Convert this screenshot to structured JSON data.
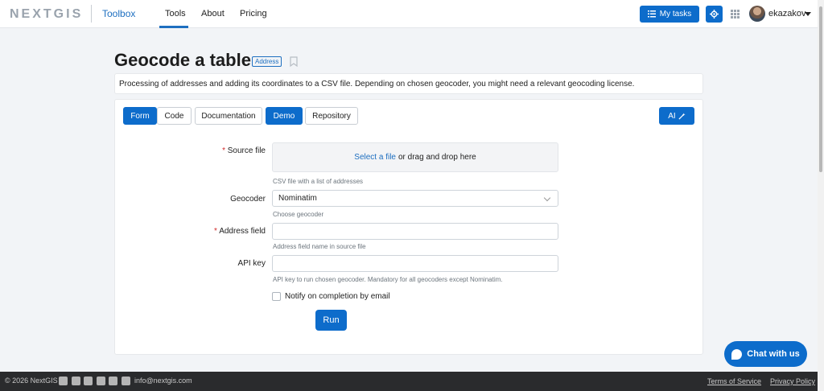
{
  "header": {
    "logo": "NEXTGIS",
    "product": "Toolbox",
    "nav": [
      "Tools",
      "About",
      "Pricing"
    ],
    "my_tasks": "My tasks",
    "username": "ekazakov"
  },
  "page": {
    "title": "Geocode a table",
    "tag": "Address",
    "description": "Processing of addresses and adding its coordinates to a CSV file. Depending on chosen geocoder, you might need a relevant geocoding license."
  },
  "tabs": [
    "Form",
    "Code",
    "Documentation",
    "Demo",
    "Repository"
  ],
  "ai_label": "AI",
  "form": {
    "source_file": {
      "label": "Source file",
      "required": "*",
      "drop_link": "Select a file",
      "drop_text": "or drag and drop here",
      "hint": "CSV file with a list of addresses"
    },
    "geocoder": {
      "label": "Geocoder",
      "value": "Nominatim",
      "hint": "Choose geocoder"
    },
    "address_field": {
      "label": "Address field",
      "required": "*",
      "value": "",
      "hint": "Address field name in source file"
    },
    "api_key": {
      "label": "API key",
      "value": "",
      "hint": "API key to run chosen geocoder. Mandatory for all geocoders except Nominatim."
    },
    "notify_label": "Notify on completion by email",
    "run_label": "Run"
  },
  "chat_label": "Chat with us",
  "footer": {
    "copyright": "© 2026 NextGIS",
    "email": "info@nextgis.com",
    "terms": "Terms of Service",
    "privacy": "Privacy Policy"
  },
  "colors": {
    "accent": "#0d6ccb",
    "footer_bg": "#2a2b2d"
  }
}
